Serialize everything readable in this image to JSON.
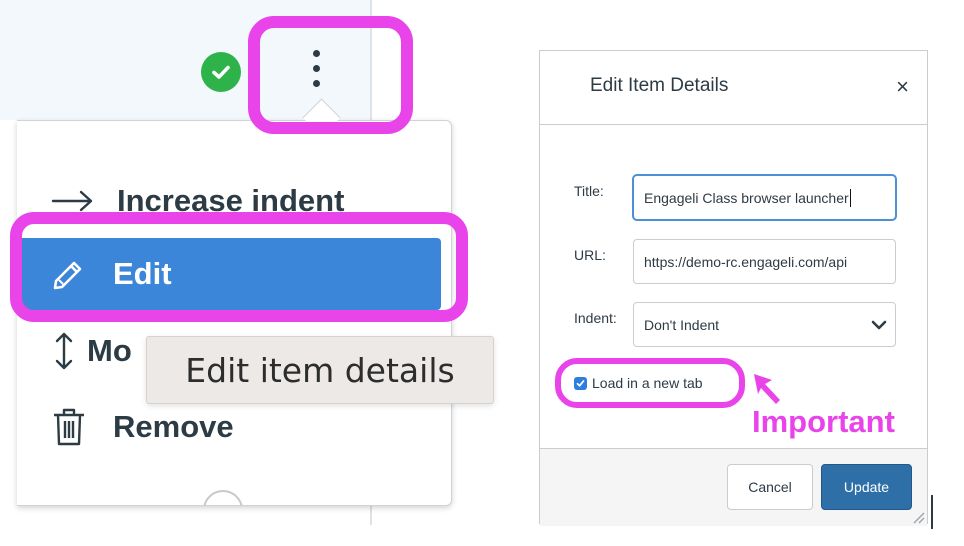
{
  "status": {
    "icon": "check-circle-icon",
    "color": "#2db34a"
  },
  "menu": {
    "items": [
      {
        "label": "Increase indent",
        "icon": "arrow-right-icon"
      },
      {
        "label": "Edit",
        "icon": "pencil-icon",
        "highlighted": true
      },
      {
        "label": "Mo",
        "icon": "move-arrows-icon"
      },
      {
        "label": "Remove",
        "icon": "trash-icon"
      }
    ],
    "tooltip": "Edit item details"
  },
  "dialog": {
    "title": "Edit Item Details",
    "close": "×",
    "fields": {
      "title": {
        "label": "Title:",
        "value": "Engageli Class browser launcher"
      },
      "url": {
        "label": "URL:",
        "value": "https://demo-rc.engageli.com/api"
      },
      "indent": {
        "label": "Indent:",
        "value": "Don't Indent"
      }
    },
    "load_new_tab": {
      "label": "Load in a new tab",
      "checked": true
    },
    "buttons": {
      "cancel": "Cancel",
      "update": "Update"
    }
  },
  "annotation": {
    "label": "Important",
    "color": "#e844ea"
  },
  "colors": {
    "accent": "#3b86d8",
    "update_button": "#2f6fa8",
    "highlight": "#e844ea"
  }
}
